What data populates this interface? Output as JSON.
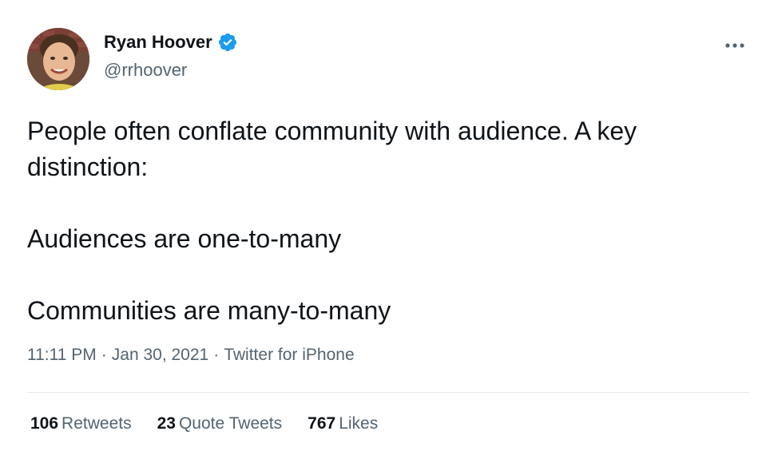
{
  "author": {
    "name": "Ryan Hoover",
    "handle": "@rrhoover",
    "verified": true,
    "verified_color": "#1d9bf0"
  },
  "tweet": {
    "lines": [
      "People often conflate community with audience. A key distinction:",
      "Audiences are one-to-many",
      "Communities are many-to-many"
    ]
  },
  "meta": {
    "time": "11:11 PM",
    "date": "Jan 30, 2021",
    "source": "Twitter for iPhone",
    "separator": "·"
  },
  "stats": {
    "retweets_count": "106",
    "retweets_label": "Retweets",
    "quotes_count": "23",
    "quotes_label": "Quote Tweets",
    "likes_count": "767",
    "likes_label": "Likes"
  },
  "icons": {
    "more": "more-horizontal-icon",
    "verified": "verified-badge-icon"
  }
}
